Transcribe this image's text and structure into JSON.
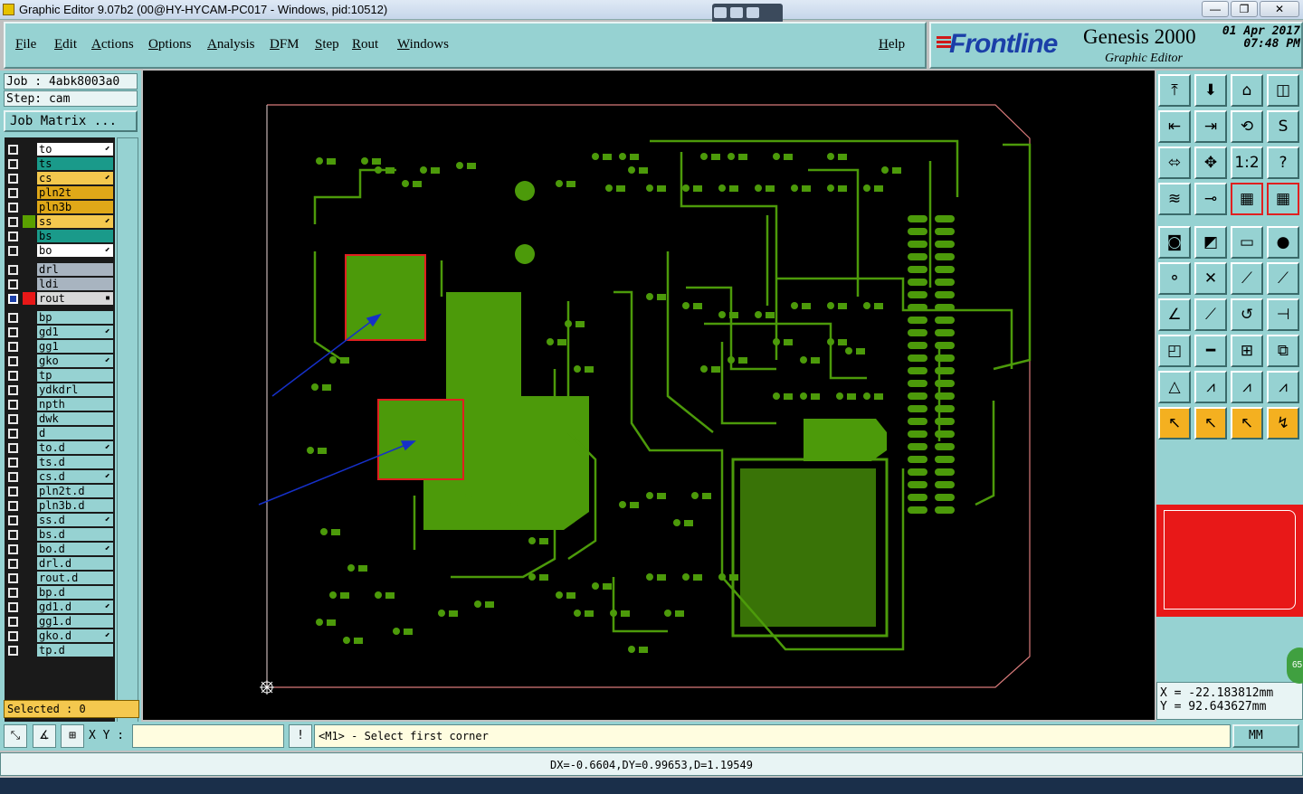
{
  "window": {
    "title": "Graphic Editor 9.07b2 (00@HY-HYCAM-PC017 - Windows, pid:10512)",
    "min": "—",
    "max": "❐",
    "close": "✕"
  },
  "menu": {
    "items": [
      {
        "label": "File",
        "name": "menu-file"
      },
      {
        "label": "Edit",
        "name": "menu-edit"
      },
      {
        "label": "Actions",
        "name": "menu-actions"
      },
      {
        "label": "Options",
        "name": "menu-options"
      },
      {
        "label": "Analysis",
        "name": "menu-analysis"
      },
      {
        "label": "DFM",
        "name": "menu-dfm"
      },
      {
        "label": "Step",
        "name": "menu-step"
      },
      {
        "label": "Rout",
        "name": "menu-rout"
      },
      {
        "label": "Windows",
        "name": "menu-windows"
      }
    ],
    "help": "Help"
  },
  "branding": {
    "logo": "Frontline",
    "product": "Genesis 2000",
    "subtitle": "Graphic Editor",
    "date": "01 Apr 2017",
    "time": "07:48 PM"
  },
  "job": {
    "job_label": "Job : 4abk8003a0",
    "step_label": "Step: cam",
    "matrix_button": "Job Matrix ..."
  },
  "layers": [
    {
      "name": "to",
      "color": "#ffffff",
      "checked": false,
      "mark": "⬋"
    },
    {
      "name": "ts",
      "color": "#1a9a8a",
      "checked": false,
      "mark": ""
    },
    {
      "name": "cs",
      "color": "#f4c84e",
      "checked": false,
      "mark": "⬋"
    },
    {
      "name": "pln2t",
      "color": "#e0a818",
      "checked": false,
      "mark": ""
    },
    {
      "name": "pln3b",
      "color": "#e0a818",
      "checked": false,
      "mark": ""
    },
    {
      "name": "ss",
      "color": "#f4c84e",
      "checked": false,
      "mark": "⬋",
      "swatch": "#5aa000"
    },
    {
      "name": "bs",
      "color": "#1a9a8a",
      "checked": false,
      "mark": ""
    },
    {
      "name": "bo",
      "color": "#ffffff",
      "checked": false,
      "mark": "⬋"
    },
    {
      "name": "drl",
      "color": "#a8b4c0",
      "checked": false,
      "mark": "",
      "gap": true
    },
    {
      "name": "ldi",
      "color": "#a8b4c0",
      "checked": false,
      "mark": ""
    },
    {
      "name": "rout",
      "color": "#d8d8d8",
      "checked": true,
      "mark": "▪",
      "swatch": "#e81818"
    },
    {
      "name": "bp",
      "color": "#96d2d2",
      "checked": false,
      "mark": "",
      "gap": true
    },
    {
      "name": "gd1",
      "color": "#96d2d2",
      "checked": false,
      "mark": "⬋"
    },
    {
      "name": "gg1",
      "color": "#96d2d2",
      "checked": false,
      "mark": ""
    },
    {
      "name": "gko",
      "color": "#96d2d2",
      "checked": false,
      "mark": "⬋"
    },
    {
      "name": "tp",
      "color": "#96d2d2",
      "checked": false,
      "mark": ""
    },
    {
      "name": "ydkdrl",
      "color": "#96d2d2",
      "checked": false,
      "mark": ""
    },
    {
      "name": "npth",
      "color": "#96d2d2",
      "checked": false,
      "mark": ""
    },
    {
      "name": "dwk",
      "color": "#96d2d2",
      "checked": false,
      "mark": ""
    },
    {
      "name": "d",
      "color": "#96d2d2",
      "checked": false,
      "mark": ""
    },
    {
      "name": "to.d",
      "color": "#96d2d2",
      "checked": false,
      "mark": "⬋"
    },
    {
      "name": "ts.d",
      "color": "#96d2d2",
      "checked": false,
      "mark": ""
    },
    {
      "name": "cs.d",
      "color": "#96d2d2",
      "checked": false,
      "mark": "⬋"
    },
    {
      "name": "pln2t.d",
      "color": "#96d2d2",
      "checked": false,
      "mark": ""
    },
    {
      "name": "pln3b.d",
      "color": "#96d2d2",
      "checked": false,
      "mark": ""
    },
    {
      "name": "ss.d",
      "color": "#96d2d2",
      "checked": false,
      "mark": "⬋"
    },
    {
      "name": "bs.d",
      "color": "#96d2d2",
      "checked": false,
      "mark": ""
    },
    {
      "name": "bo.d",
      "color": "#96d2d2",
      "checked": false,
      "mark": "⬋"
    },
    {
      "name": "drl.d",
      "color": "#96d2d2",
      "checked": false,
      "mark": ""
    },
    {
      "name": "rout.d",
      "color": "#96d2d2",
      "checked": false,
      "mark": ""
    },
    {
      "name": "bp.d",
      "color": "#96d2d2",
      "checked": false,
      "mark": ""
    },
    {
      "name": "gd1.d",
      "color": "#96d2d2",
      "checked": false,
      "mark": "⬋"
    },
    {
      "name": "gg1.d",
      "color": "#96d2d2",
      "checked": false,
      "mark": ""
    },
    {
      "name": "gko.d",
      "color": "#96d2d2",
      "checked": false,
      "mark": "⬋"
    },
    {
      "name": "tp.d",
      "color": "#96d2d2",
      "checked": false,
      "mark": ""
    }
  ],
  "selected": "Selected : 0",
  "toolbar": [
    {
      "icon": "⤒",
      "name": "tool-zoom-home"
    },
    {
      "icon": "⬇",
      "name": "tool-zoom-down"
    },
    {
      "icon": "⌂",
      "name": "tool-home"
    },
    {
      "icon": "◫",
      "name": "tool-window"
    },
    {
      "icon": "⇤",
      "name": "tool-pan-left"
    },
    {
      "icon": "⇥",
      "name": "tool-pan-right"
    },
    {
      "icon": "⟲",
      "name": "tool-rotate"
    },
    {
      "icon": "S",
      "name": "tool-snap"
    },
    {
      "icon": "⬄",
      "name": "tool-fit"
    },
    {
      "icon": "✥",
      "name": "tool-center"
    },
    {
      "icon": "1:2",
      "name": "tool-scale"
    },
    {
      "icon": "?",
      "name": "tool-help"
    },
    {
      "icon": "≋",
      "name": "tool-graphic-control"
    },
    {
      "icon": "⊸",
      "name": "tool-measure"
    },
    {
      "icon": "▦",
      "name": "tool-layers-a",
      "red": true
    },
    {
      "icon": "▦",
      "name": "tool-layers-b",
      "red": true
    },
    {
      "icon": "◙",
      "name": "tool-pad"
    },
    {
      "icon": "◩",
      "name": "tool-polygon"
    },
    {
      "icon": "▭",
      "name": "tool-ruler"
    },
    {
      "icon": "●",
      "name": "tool-circle"
    },
    {
      "icon": "⚬",
      "name": "tool-net"
    },
    {
      "icon": "✕",
      "name": "tool-cross"
    },
    {
      "icon": "⟋",
      "name": "tool-line"
    },
    {
      "icon": "⟋",
      "name": "tool-line-red"
    },
    {
      "icon": "∠",
      "name": "tool-angle"
    },
    {
      "icon": "⟋",
      "name": "tool-slash"
    },
    {
      "icon": "↺",
      "name": "tool-arc"
    },
    {
      "icon": "⊣",
      "name": "tool-split"
    },
    {
      "icon": "◰",
      "name": "tool-box"
    },
    {
      "icon": "━",
      "name": "tool-hline"
    },
    {
      "icon": "⊞",
      "name": "tool-grid"
    },
    {
      "icon": "⧉",
      "name": "tool-copy"
    },
    {
      "icon": "△",
      "name": "tool-tri-a"
    },
    {
      "icon": "⩘",
      "name": "tool-tri-b"
    },
    {
      "icon": "⩘",
      "name": "tool-tri-c"
    },
    {
      "icon": "⩘",
      "name": "tool-tri-d"
    },
    {
      "icon": "↖",
      "name": "tool-select",
      "yellow": true
    },
    {
      "icon": "↖",
      "name": "tool-select-b",
      "yellow": true
    },
    {
      "icon": "↖",
      "name": "tool-select-c",
      "yellow": true
    },
    {
      "icon": "↯",
      "name": "tool-select-d",
      "yellow": true
    }
  ],
  "coords": {
    "x": "X = -22.183812mm",
    "y": "Y = 92.643627mm"
  },
  "bottom": {
    "xy_label": "X Y :",
    "xy_value": "",
    "message": "<M1> - Select first corner",
    "units": "MM",
    "status": "DX=-0.6604,DY=0.99653,D=1.19549"
  },
  "badge": "65"
}
